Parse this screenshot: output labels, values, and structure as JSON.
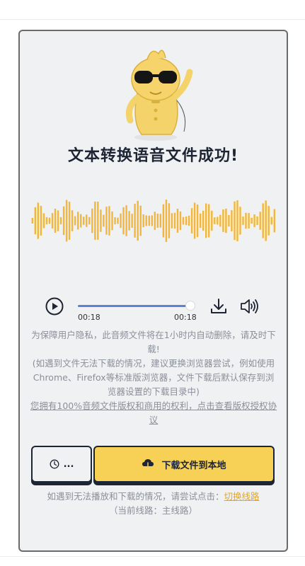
{
  "page": {
    "title": "文本转换语音文件成功!"
  },
  "player": {
    "current_time": "00:18",
    "duration": "00:18",
    "progress": 1.0
  },
  "notice": {
    "line1": "为保障用户隐私，此音频文件将在1小时内自动删除，请及时下载!",
    "line2": "(如遇到文件无法下载的情况，建议更换浏览器尝试，例如使用Chrome、Firefox等标准版浏览器，文件下载后默认保存到浏览器设置的下载目录中)",
    "license_link": "您拥有100%音频文件版权和商用的权利，点击查看版权授权协议"
  },
  "buttons": {
    "history_label": "...",
    "download_label": "下载文件到本地"
  },
  "route": {
    "prompt": "如遇到无法播放和下载的情况，请尝试点击：",
    "switch_label": "切换线路",
    "current": "（当前线路：主线路）"
  },
  "colors": {
    "accent_yellow": "#f7d155",
    "wave_yellow": "#f2b63a",
    "dark": "#1d2433",
    "progress_blue": "#5b82d6",
    "muted_text": "#8a8f98"
  },
  "icons": {
    "play": "play-icon",
    "download": "download-icon",
    "volume": "volume-icon",
    "clock": "clock-icon",
    "cloud_download": "cloud-download-icon"
  }
}
